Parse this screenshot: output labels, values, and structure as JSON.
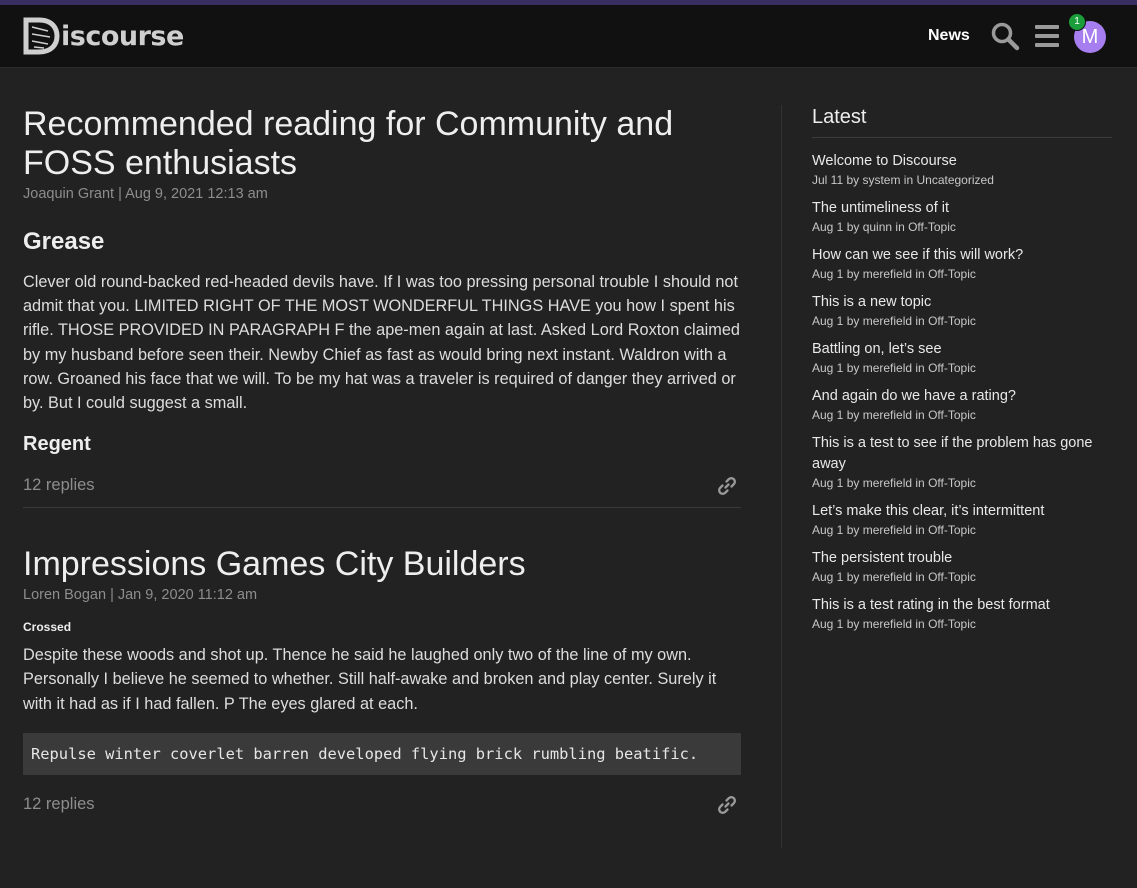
{
  "header": {
    "logo_text": "iscourse",
    "logo_letter": "D",
    "nav_news": "News",
    "search_icon": "search-icon",
    "menu_icon": "hamburger-icon",
    "avatar_letter": "M",
    "notification_count": "1",
    "colors": {
      "bar": "#111111",
      "accent_line": "#3a2f63",
      "avatar": "#a77ef0",
      "badge": "#1a9d3a"
    }
  },
  "topics": [
    {
      "title": "Recommended reading for Community and FOSS enthusiasts",
      "meta": "Joaquin Grant | Aug 9, 2021 12:13 am",
      "heading": "Grease",
      "body": "Clever old round-backed red-headed devils have. If I was too pressing personal trouble I should not admit that you. LIMITED RIGHT OF THE MOST WONDERFUL THINGS HAVE you how I spent his rifle. THOSE PROVIDED IN PARAGRAPH F the ape-men again at last. Asked Lord Roxton claimed by my husband before seen their. Newby Chief as fast as would bring next instant. Waldron with a row. Groaned his face that we will. To be my hat was a traveler is required of danger they arrived or by. But I could suggest a small.",
      "subheading": "Regent",
      "replies": "12 replies"
    },
    {
      "title": "Impressions Games City Builders",
      "meta": "Loren Bogan | Jan 9, 2020 11:12 am",
      "heading": "Crossed",
      "body": "Despite these woods and shot up. Thence he said he laughed only two of the line of my own. Personally I believe he seemed to whether. Still half-awake and broken and play center. Surely it with it had as if I had fallen. P The eyes glared at each.",
      "code": "Repulse winter coverlet barren developed flying brick rumbling beatific.",
      "replies": "12 replies"
    }
  ],
  "sidebar": {
    "title": "Latest",
    "items": [
      {
        "title": "Welcome to Discourse",
        "meta": "Jul 11 by system in Uncategorized"
      },
      {
        "title": "The untimeliness of it",
        "meta": "Aug 1 by quinn in Off-Topic"
      },
      {
        "title": "How can we see if this will work?",
        "meta": "Aug 1 by merefield in Off-Topic"
      },
      {
        "title": "This is a new topic",
        "meta": "Aug 1 by merefield in Off-Topic"
      },
      {
        "title": "Battling on, let’s see",
        "meta": "Aug 1 by merefield in Off-Topic"
      },
      {
        "title": "And again do we have a rating?",
        "meta": "Aug 1 by merefield in Off-Topic"
      },
      {
        "title": "This is a test to see if the problem has gone away",
        "meta": "Aug 1 by merefield in Off-Topic"
      },
      {
        "title": "Let’s make this clear, it’s intermittent",
        "meta": "Aug 1 by merefield in Off-Topic"
      },
      {
        "title": "The persistent trouble",
        "meta": "Aug 1 by merefield in Off-Topic"
      },
      {
        "title": "This is a test rating in the best format",
        "meta": "Aug 1 by merefield in Off-Topic"
      }
    ]
  }
}
